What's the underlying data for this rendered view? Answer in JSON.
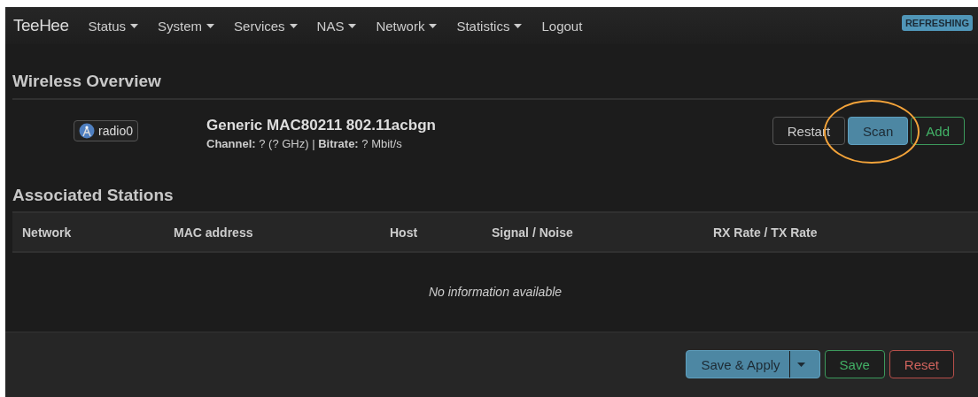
{
  "navbar": {
    "brand": "TeeHee",
    "menus": [
      {
        "label": "Status",
        "dropdown": true
      },
      {
        "label": "System",
        "dropdown": true
      },
      {
        "label": "Services",
        "dropdown": true
      },
      {
        "label": "NAS",
        "dropdown": true
      },
      {
        "label": "Network",
        "dropdown": true
      },
      {
        "label": "Statistics",
        "dropdown": true
      },
      {
        "label": "Logout",
        "dropdown": false
      }
    ],
    "badge": "REFRESHING"
  },
  "overview": {
    "title": "Wireless Overview",
    "devices": [
      {
        "name": "radio0",
        "model": "Generic MAC80211 802.11acbgn",
        "details": "**Channel:** ? (? GHz) | **Bitrate:** ? Mbit/s",
        "buttons": [
          {
            "label": "Restart",
            "kind": "default",
            "highlighted": false
          },
          {
            "label": "Scan",
            "kind": "primary",
            "highlighted": true
          },
          {
            "label": "Add",
            "kind": "positive",
            "highlighted": false
          }
        ]
      }
    ]
  },
  "stations": {
    "title": "Associated Stations",
    "columns": [
      "Network",
      "MAC address",
      "Host",
      "Signal / Noise",
      "RX Rate / TX Rate"
    ],
    "empty_message": "No information available"
  },
  "footer": {
    "buttons": [
      {
        "label": "Save & Apply",
        "kind": "primary",
        "dropdown": true
      },
      {
        "label": "Save",
        "kind": "positive",
        "dropdown": false
      },
      {
        "label": "Reset",
        "kind": "negative",
        "dropdown": false
      }
    ]
  }
}
